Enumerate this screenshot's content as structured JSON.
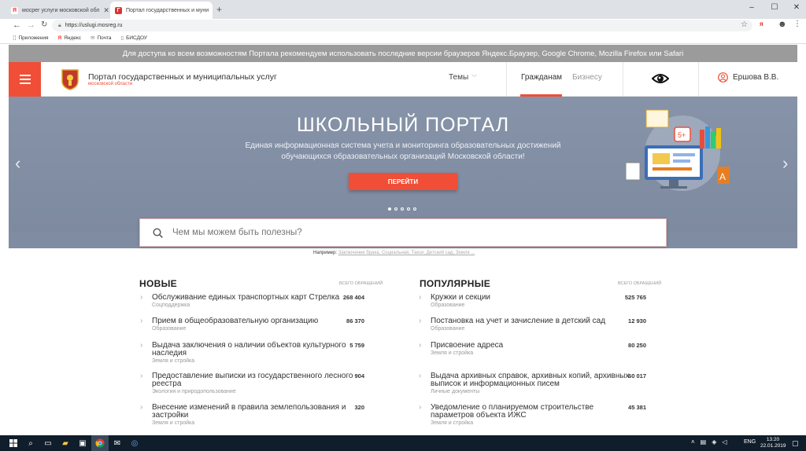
{
  "browser": {
    "tabs": [
      {
        "label": "мосрег услуги московской обл",
        "favicon": "Я"
      },
      {
        "label": "Портал государственных и муни",
        "favicon": "Г"
      }
    ],
    "new_tab_icon": "plus-icon",
    "url": "https://uslugi.mosreg.ru",
    "bookmarks": [
      "Приложения",
      "Яндекс",
      "Почта",
      "БИСДОУ"
    ]
  },
  "notice": "Для доступа ко всем возможностям Портала рекомендуем использовать последние версии браузеров Яндекс.Браузер, Google Chrome, Mozilla Firefox или Safari",
  "header": {
    "title": "Портал государственных и муниципальных услуг",
    "subtitle": "московской области",
    "topics": "Темы",
    "tab_citizens": "Гражданам",
    "tab_business": "Бизнесу",
    "user": "Ершова В.В."
  },
  "hero": {
    "title": "ШКОЛЬНЫЙ ПОРТАЛ",
    "line1": "Единая информационная система учета и мониторинга образовательных достижений",
    "line2": "обучающихся образовательных организаций Московской области!",
    "button": "ПЕРЕЙТИ",
    "slides_total": 5,
    "active_slide": 1,
    "illustration_letters": {
      "grade": "5+",
      "book": "A"
    }
  },
  "search": {
    "placeholder": "Чем мы можем быть полезны?",
    "examples_label": "Например:",
    "examples": "Заключение брака, Социальная, Такси, Детский сад, Земля ..."
  },
  "new_services": {
    "title": "НОВЫЕ",
    "meta": "ВСЕГО ОБРАЩЕНИЙ",
    "items": [
      {
        "name": "Обслуживание единых транспортных карт Стрелка",
        "name2": "",
        "category": "Соцподдержка",
        "count": "268 404"
      },
      {
        "name": "Прием в общеобразовательную организацию",
        "name2": "",
        "category": "Образование",
        "count": "86 370"
      },
      {
        "name": "Выдача заключения о наличии объектов культурного",
        "name2": "наследия",
        "category": "Земля и стройка",
        "count": "5 759"
      },
      {
        "name": "Предоставление выписки из государственного лесного",
        "name2": "реестра",
        "category": "Экология и природопользование",
        "count": "904"
      },
      {
        "name": "Внесение изменений в правила землепользования и",
        "name2": "застройки",
        "category": "Земля и стройка",
        "count": "320"
      }
    ]
  },
  "popular_services": {
    "title": "ПОПУЛЯРНЫЕ",
    "meta": "ВСЕГО ОБРАЩЕНИЙ",
    "items": [
      {
        "name": "Кружки и секции",
        "name2": "",
        "category": "Образование",
        "count": "525 765"
      },
      {
        "name": "Постановка на учет и зачисление в детский сад",
        "name2": "",
        "category": "Образование",
        "count": "12 930"
      },
      {
        "name": "Присвоение адреса",
        "name2": "",
        "category": "Земля и стройка",
        "count": "80 250"
      },
      {
        "name": "Выдача архивных справок, архивных копий, архивных",
        "name2": "выписок и информационных писем",
        "category": "Личные документы",
        "count": "60 017"
      },
      {
        "name": "Уведомление о планируемом строительстве",
        "name2": "параметров объекта ИЖС",
        "category": "Земля и стройка",
        "count": "45 381"
      }
    ]
  },
  "taskbar": {
    "lang": "ENG",
    "time": "13:20",
    "date": "22.01.2019"
  },
  "colors": {
    "accent": "#f04e37",
    "hero_bg": "#8693a8",
    "notice_bg": "#9b9b9b",
    "taskbar_bg": "#101d2b"
  }
}
